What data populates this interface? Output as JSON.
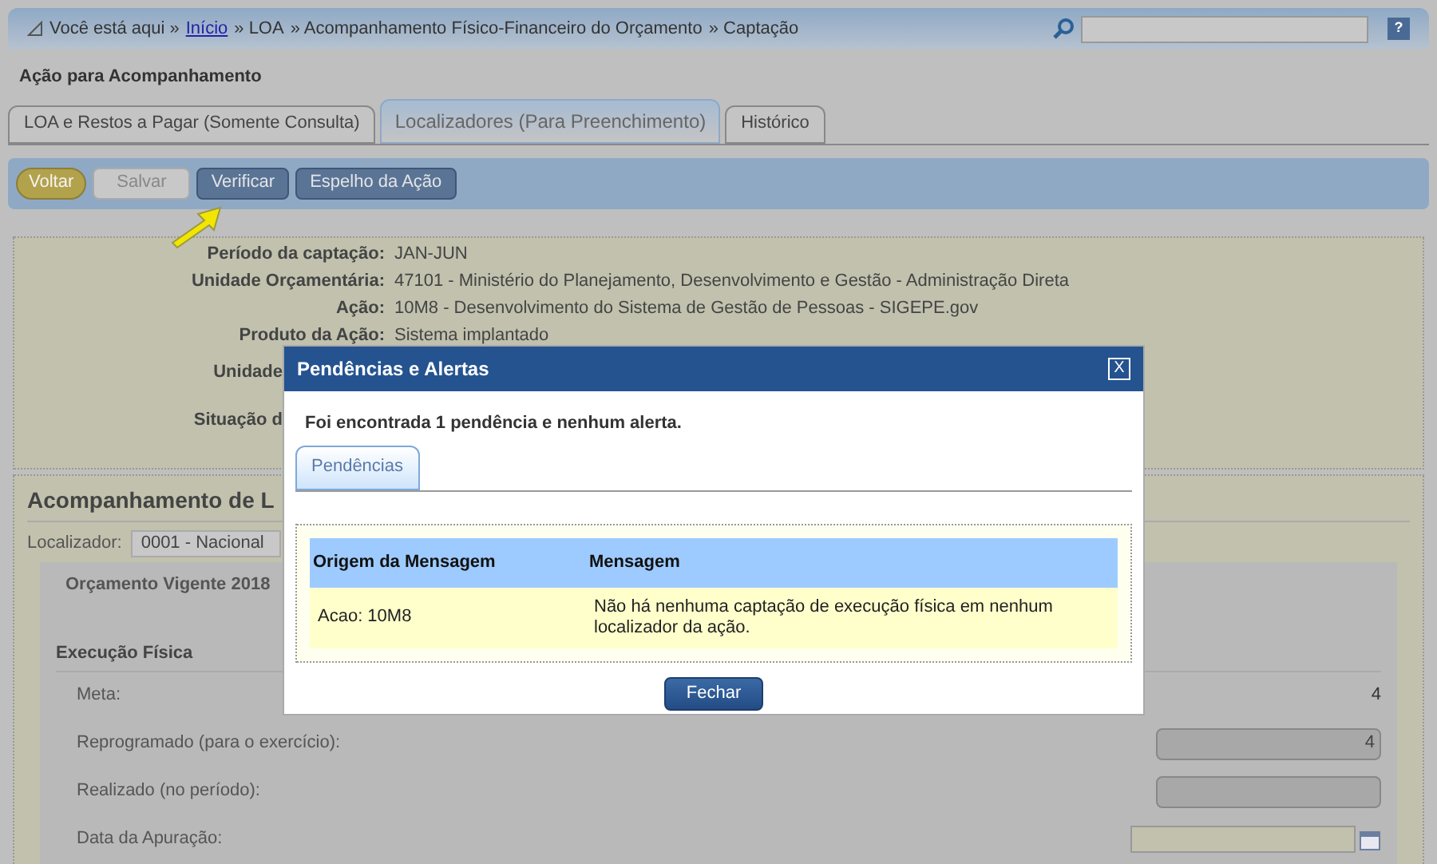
{
  "breadcrumb": {
    "prefix": "Você está aqui »",
    "items": [
      {
        "label": "Início",
        "kind": "link"
      },
      {
        "label": "» LOA",
        "kind": "text"
      },
      {
        "label": "» Acompanhamento Físico-Financeiro do Orçamento",
        "kind": "text"
      },
      {
        "label": "» Captação",
        "kind": "text"
      }
    ]
  },
  "help": "?",
  "page_title": "Ação para Acompanhamento",
  "tabs": [
    {
      "label": "LOA e Restos a Pagar (Somente Consulta)",
      "selected": false
    },
    {
      "label": "Localizadores (Para Preenchimento)",
      "selected": true
    },
    {
      "label": "Histórico",
      "selected": false
    }
  ],
  "toolbar": [
    {
      "label": "Voltar",
      "kind": "back"
    },
    {
      "label": "Salvar",
      "kind": "disabled"
    },
    {
      "label": "Verificar",
      "kind": "normal"
    },
    {
      "label": "Espelho da Ação",
      "kind": "normal"
    }
  ],
  "info": [
    {
      "label": "Período da captação:",
      "value": "JAN-JUN",
      "kind": "full"
    },
    {
      "label": "Unidade Orçamentária:",
      "value": "47101 - Ministério do Planejamento, Desenvolvimento e Gestão - Administração Direta",
      "kind": "full"
    },
    {
      "label": "Ação:",
      "value": "10M8 - Desenvolvimento do Sistema de Gestão de Pessoas - SIGEPE.gov",
      "kind": "full"
    },
    {
      "label": "Produto da Ação:",
      "value": "Sistema implantado",
      "kind": "full"
    },
    {
      "label": "Unidade",
      "kind": "covered"
    },
    {
      "label": "Situação d",
      "kind": "covered"
    }
  ],
  "section": {
    "title": "Acompanhamento de L",
    "locator_label": "Localizador:",
    "locator_value": "0001 - Nacional",
    "fieldset": "Orçamento Vigente 2018",
    "subtitle": "Execução Física",
    "rows": [
      {
        "label": "Meta:",
        "value": "4",
        "kind": "text"
      },
      {
        "label": "Reprogramado (para o exercício):",
        "value": "4",
        "kind": "input"
      },
      {
        "label": "Realizado (no período):",
        "kind": "input"
      },
      {
        "label": "Data da Apuração:",
        "kind": "date"
      }
    ]
  },
  "dialog": {
    "title": "Pendências e Alertas",
    "close": "X",
    "message": "Foi encontrada 1 pendência e nenhum alerta.",
    "tabs": [
      {
        "label": "Pendências",
        "selected": true
      }
    ],
    "columns": [
      "Origem da Mensagem",
      "Mensagem"
    ],
    "rows": [
      [
        "Acao: 10M8",
        "Não há nenhuma captação de execução física em nenhum localizador da ação."
      ]
    ],
    "button": "Fechar"
  }
}
